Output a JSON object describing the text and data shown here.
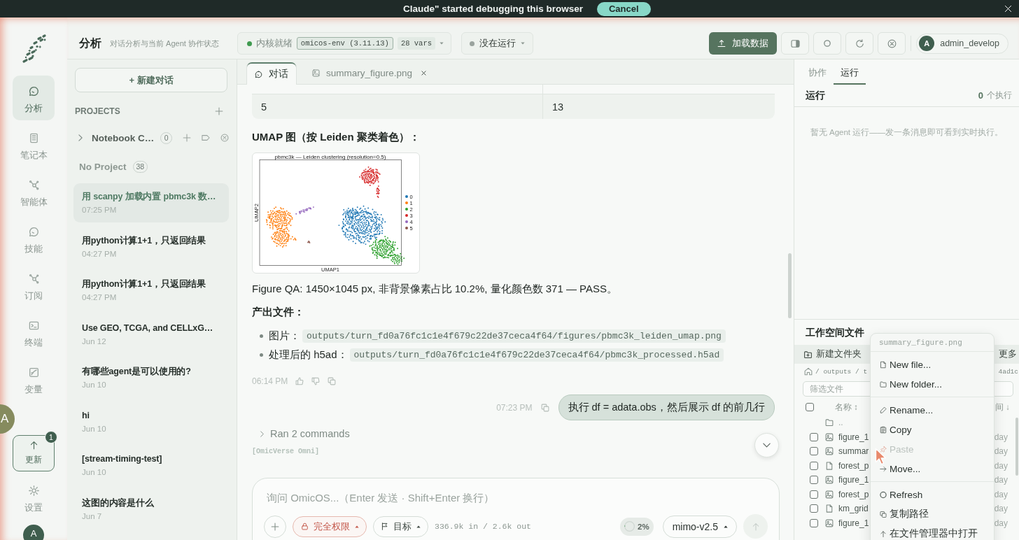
{
  "banner": {
    "message": "Claude\" started debugging this browser",
    "cancel": "Cancel"
  },
  "rail": {
    "items": [
      {
        "label": "分析",
        "selected": true
      },
      {
        "label": "笔记本",
        "selected": false
      },
      {
        "label": "智能体",
        "selected": false
      },
      {
        "label": "技能",
        "selected": false
      },
      {
        "label": "订阅",
        "selected": false
      },
      {
        "label": "终端",
        "selected": false
      },
      {
        "label": "变量",
        "selected": false
      }
    ],
    "translate": "A",
    "update": {
      "label": "更新",
      "badge": "1"
    },
    "settings": "设置",
    "avatar": "A"
  },
  "header": {
    "title": "分析",
    "subtitle": "对话分析与当前 Agent 协作状态",
    "kernel": {
      "ready": true,
      "status": "内核就绪",
      "env": "omicos-env (3.11.13)",
      "vars": "28 vars"
    },
    "run_state": {
      "running": false,
      "label": "没在运行"
    },
    "load_button": "加载数据",
    "user": {
      "avatar": "A",
      "name": "admin_develop"
    }
  },
  "sidebar": {
    "new_chat": "+ 新建对话",
    "projects_title": "PROJECTS",
    "projects": [
      {
        "name": "Notebook C…",
        "count": "0",
        "expanded": false
      }
    ],
    "no_project": {
      "label": "No Project",
      "count": "38"
    },
    "conversations": [
      {
        "title": "用 scanpy 加载内置 pbmc3k 数…",
        "time": "07:25 PM",
        "selected": true
      },
      {
        "title": "用python计算1+1，只返回结果",
        "time": "04:27 PM",
        "selected": false
      },
      {
        "title": "用python计算1+1，只返回结果",
        "time": "04:27 PM",
        "selected": false
      },
      {
        "title": "Use GEO, TCGA, and CELLxG…",
        "time": "Jun 12",
        "selected": false
      },
      {
        "title": "有哪些agent是可以使用的?",
        "time": "Jun 10",
        "selected": false
      },
      {
        "title": "hi",
        "time": "Jun 10",
        "selected": false
      },
      {
        "title": "[stream-timing-test]",
        "time": "Jun 10",
        "selected": false
      },
      {
        "title": "这图的内容是什么",
        "time": "Jun 7",
        "selected": false
      }
    ]
  },
  "chat": {
    "tabs": [
      {
        "label": "对话",
        "selected": true,
        "closable": false
      },
      {
        "label": "summary_figure.png",
        "selected": false,
        "closable": true
      }
    ],
    "table_rows": [
      [
        "5",
        "13"
      ]
    ],
    "heading": "UMAP 图（按 Leiden 聚类着色）：",
    "figure": {
      "title": "pbmc3k — Leiden clustering (resolution=0.5)",
      "xlabel": "UMAP1",
      "ylabel": "UMAP2",
      "legend": [
        {
          "label": "0",
          "color": "#1f77b4"
        },
        {
          "label": "1",
          "color": "#ff7f0e"
        },
        {
          "label": "2",
          "color": "#2ca02c"
        },
        {
          "label": "3",
          "color": "#d62728"
        },
        {
          "label": "4",
          "color": "#9467bd"
        },
        {
          "label": "5",
          "color": "#8c564b"
        }
      ]
    },
    "qa_text": "Figure QA: 1450×1045 px, 非背景像素占比 10.2%, 量化颜色数 371 — PASS。",
    "outputs_title": "产出文件：",
    "outputs": [
      {
        "label": "图片：",
        "path": "outputs/turn_fd0a76fc1c1e4f679c22de37ceca4f64/figures/pbmc3k_leiden_umap.png"
      },
      {
        "label": "处理后的 h5ad：",
        "path": "outputs/turn_fd0a76fc1c1e4f679c22de37ceca4f64/pbmc3k_processed.h5ad"
      }
    ],
    "reply_time": "06:14 PM",
    "user_message": {
      "text": "执行 df = adata.obs，然后展示 df 的前几行",
      "time": "07:23 PM"
    },
    "commands": {
      "label": "Ran 2 commands",
      "expanded": false
    },
    "agent_tag": "[OmicVerse Omni]"
  },
  "composer": {
    "placeholder": "询问 OmicOS...（Enter 发送 · Shift+Enter 换行）",
    "permission": "完全权限",
    "goal": "目标",
    "tokens": "336.9k in / 2.6k out",
    "context": {
      "label": "2%",
      "level": 0.02
    },
    "model": "mimo-v2.5",
    "send_disabled": true
  },
  "right_panel": {
    "tabs": [
      {
        "label": "协作",
        "selected": false
      },
      {
        "label": "运行",
        "selected": true
      }
    ],
    "runs_title": "运行",
    "runs_count": "0",
    "runs_unit": "个执行",
    "empty_text": "暂无 Agent 运行——发一条消息即可看到实时执行。"
  },
  "workspace": {
    "title": "工作空间文件",
    "new_folder": "新建文件夹",
    "more": "更多",
    "breadcrumb": "/ outputs / t",
    "breadcrumb_tail": "4ad1c",
    "filter_placeholder": "筛选文件",
    "all_checked": false,
    "columns": [
      "名称 ↕",
      "间 ↓"
    ],
    "files": [
      {
        "name": "..",
        "kind": "folder"
      },
      {
        "name": "figure_1",
        "kind": "image",
        "time": "day",
        "checked": false
      },
      {
        "name": "summar",
        "kind": "image",
        "time": "day",
        "checked": false
      },
      {
        "name": "forest_p",
        "kind": "file",
        "time": "day",
        "checked": false
      },
      {
        "name": "figure_1",
        "kind": "image",
        "time": "day",
        "checked": false
      },
      {
        "name": "forest_p",
        "kind": "image",
        "time": "day",
        "checked": false
      },
      {
        "name": "km_grid",
        "kind": "file",
        "time": "day",
        "checked": false
      },
      {
        "name": "figure_1",
        "kind": "image",
        "time": "day",
        "checked": false
      }
    ]
  },
  "context_menu": {
    "title": "summary_figure.png",
    "groups": [
      [
        {
          "label": "New file...",
          "disabled": false
        },
        {
          "label": "New folder...",
          "disabled": false
        }
      ],
      [
        {
          "label": "Rename...",
          "disabled": false
        },
        {
          "label": "Copy",
          "disabled": false
        },
        {
          "label": "Paste",
          "disabled": true
        },
        {
          "label": "Move...",
          "disabled": false
        }
      ],
      [
        {
          "label": "Refresh",
          "disabled": false
        },
        {
          "label": "复制路径",
          "disabled": false
        },
        {
          "label": "在文件管理器中打开",
          "disabled": false
        }
      ]
    ]
  }
}
